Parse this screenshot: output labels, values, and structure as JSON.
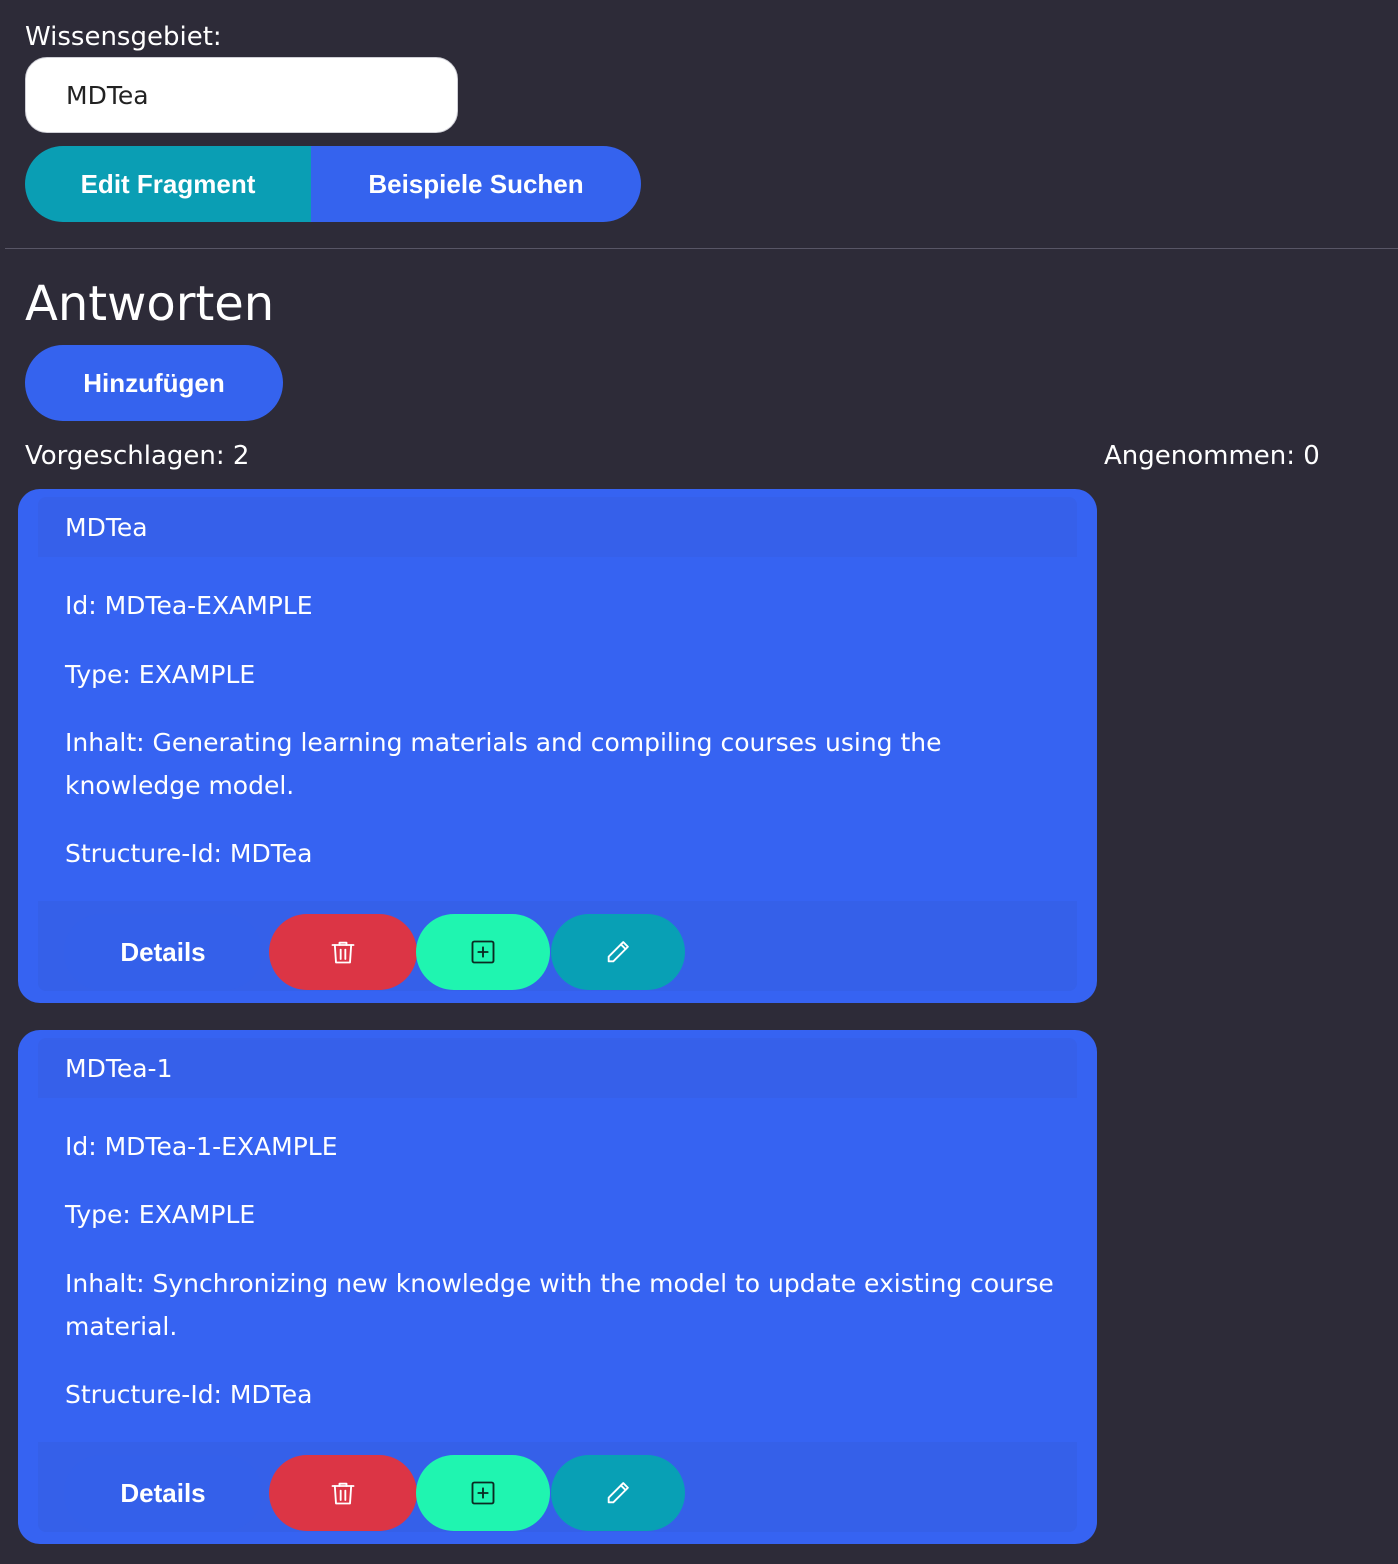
{
  "form": {
    "label": "Wissensgebiet:",
    "input_value": "MDTea"
  },
  "toolbar": {
    "edit_label": "Edit Fragment",
    "search_label": "Beispiele Suchen"
  },
  "section": {
    "heading": "Antworten",
    "add_label": "Hinzufügen",
    "suggested": "Vorgeschlagen: 2",
    "accepted": "Angenommen: 0"
  },
  "cards": [
    {
      "title": "MDTea",
      "id": "Id: MDTea-EXAMPLE",
      "type": "Type: EXAMPLE",
      "content": "Inhalt: Generating learning materials and compiling courses using the knowledge model.",
      "structure": "Structure-Id: MDTea",
      "details_label": "Details"
    },
    {
      "title": "MDTea-1",
      "id": "Id: MDTea-1-EXAMPLE",
      "type": "Type: EXAMPLE",
      "content": "Inhalt: Synchronizing new knowledge with the model to update existing course material.",
      "structure": "Structure-Id: MDTea",
      "details_label": "Details"
    }
  ],
  "icons": {
    "delete": "trash-icon",
    "add": "plus-square-icon",
    "edit": "pencil-icon"
  },
  "colors": {
    "background": "#2d2b38",
    "primary": "#3563ee",
    "card": "#3663f2",
    "teal": "#0a9eb4",
    "danger": "#dc3545",
    "success": "#1ff5b0"
  }
}
